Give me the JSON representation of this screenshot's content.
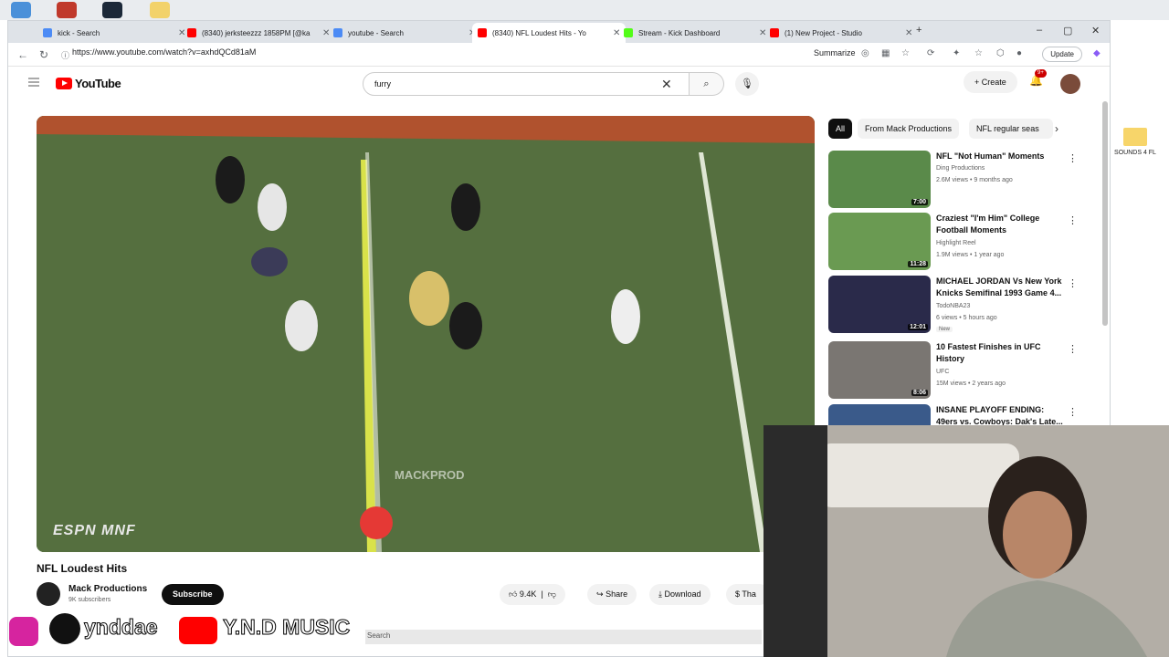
{
  "browser": {
    "tabs": [
      {
        "label": "kick - Search",
        "color": "#4c8bf5",
        "active": false
      },
      {
        "label": "(8340) jerksteezzz 1858PM [@ka",
        "color": "#ff0000",
        "active": false
      },
      {
        "label": "youtube - Search",
        "color": "#4c8bf5",
        "active": false
      },
      {
        "label": "(8340) NFL Loudest Hits - Yo",
        "color": "#ff0000",
        "active": true
      },
      {
        "label": "Stream - Kick Dashboard",
        "color": "#53fc18",
        "active": false
      },
      {
        "label": "(1) New Project - Studio",
        "color": "#ff0000",
        "active": false
      }
    ],
    "url": "https://www.youtube.com/watch?v=axhdQCd81aM",
    "summarize_label": "Summarize",
    "update_label": "Update"
  },
  "youtube": {
    "logo_text": "YouTube",
    "search_value": "furry",
    "create_label": "Create",
    "notif_badge": "9+"
  },
  "video": {
    "watermark": "MACKPROD",
    "network_logo": "ESPN MNF",
    "title": "NFL Loudest Hits",
    "channel": "Mack Productions",
    "subscribers": "9K subscribers",
    "subscribe_label": "Subscribe",
    "likes": "9.4K",
    "share_label": "Share",
    "download_label": "Download",
    "thanks_label": "Tha"
  },
  "chips": {
    "all": "All",
    "from": "From Mack Productions",
    "nfl": "NFL regular seas"
  },
  "recommendations": [
    {
      "title": "NFL \"Not Human\" Moments",
      "channel": "Ding Productions",
      "meta": "2.6M views • 9 months ago",
      "duration": "7:00",
      "thumb": "#5a8a4a"
    },
    {
      "title": "Craziest \"I'm Him\" College Football Moments",
      "channel": "Highlight Reel",
      "meta": "1.9M views • 1 year ago",
      "duration": "11:28",
      "thumb": "#6a9a52"
    },
    {
      "title": "MICHAEL JORDAN Vs New York Knicks Semifinal 1993 Game 4...",
      "channel": "TodoNBA23",
      "meta": "6 views • 5 hours ago",
      "duration": "12:01",
      "thumb": "#2a2a4a",
      "new": "New"
    },
    {
      "title": "10 Fastest Finishes in UFC History",
      "channel": "UFC",
      "meta": "15M views • 2 years ago",
      "duration": "8:06",
      "thumb": "#7a7672"
    },
    {
      "title": "INSANE PLAYOFF ENDING: 49ers vs. Cowboys: Dak's Late...",
      "channel": "",
      "meta": "",
      "duration": "",
      "thumb": "#3a5a8a"
    }
  ],
  "overlay": {
    "tiktok_handle": "ynddae",
    "youtube_channel": "Y.N.D MUSIC",
    "taskbar_search": "Search"
  },
  "desktop": {
    "folder_label": "SOUNDS 4 FL"
  }
}
